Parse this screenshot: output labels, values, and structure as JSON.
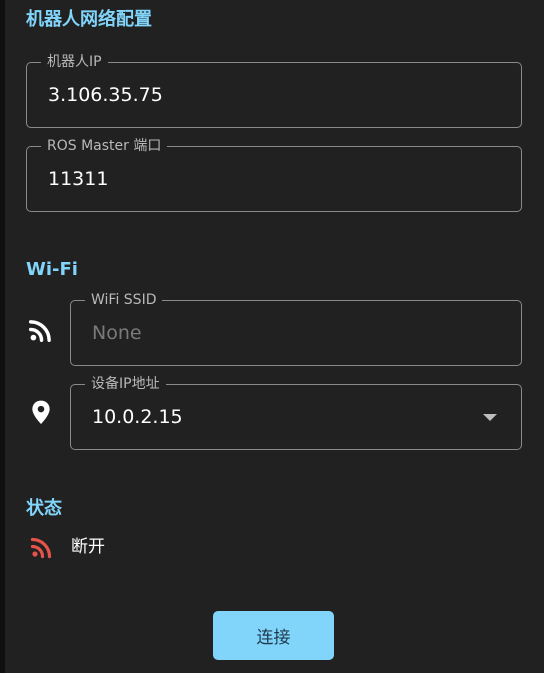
{
  "robot_network": {
    "title": "机器人网络配置",
    "robot_ip": {
      "label": "机器人IP",
      "value": "3.106.35.75"
    },
    "ros_master_port": {
      "label": "ROS Master 端口",
      "value": "11311"
    }
  },
  "wifi": {
    "title": "Wi-Fi",
    "ssid": {
      "label": "WiFi SSID",
      "placeholder": "None",
      "icon": "wifi-icon"
    },
    "device_ip": {
      "label": "设备IP地址",
      "value": "10.0.2.15",
      "icon": "location-pin-icon"
    }
  },
  "status": {
    "title": "状态",
    "text": "断开",
    "icon": "wifi-disconnected-icon",
    "color": "#e5534b"
  },
  "actions": {
    "connect_label": "连接"
  },
  "colors": {
    "accent": "#81d4fa",
    "background": "#212121"
  }
}
